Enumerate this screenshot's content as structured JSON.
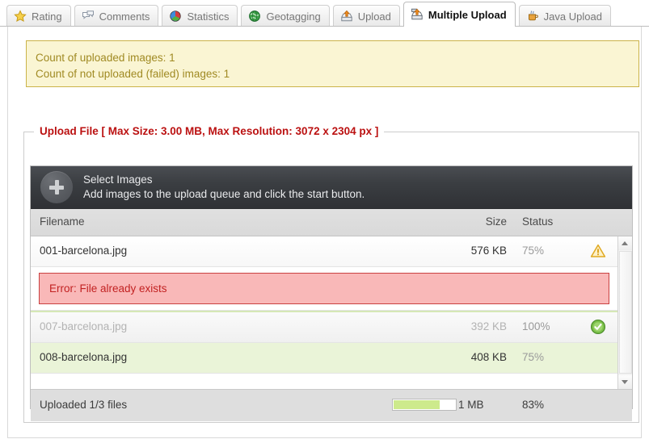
{
  "tabs": [
    {
      "label": "Rating",
      "icon": "star-icon",
      "active": false
    },
    {
      "label": "Comments",
      "icon": "speech-bubble-icon",
      "active": false
    },
    {
      "label": "Statistics",
      "icon": "pie-chart-icon",
      "active": false
    },
    {
      "label": "Geotagging",
      "icon": "globe-icon",
      "active": false
    },
    {
      "label": "Upload",
      "icon": "upload-tray-icon",
      "active": false
    },
    {
      "label": "Multiple Upload",
      "icon": "upload-tray-icon",
      "active": true
    },
    {
      "label": "Java Upload",
      "icon": "java-cup-icon",
      "active": false
    }
  ],
  "notice": {
    "line1": "Count of uploaded images: 1",
    "line2": "Count of not uploaded (failed) images: 1",
    "bg": "#faf5d3",
    "border": "#cbb34a",
    "text": "#a08a23"
  },
  "fieldset": {
    "legend": "Upload File [ Max Size: 3.00 MB, Max Resolution: 3072 x 2304 px ]",
    "legend_color": "#bb1111"
  },
  "dropzone": {
    "title": "Select Images",
    "subtitle": "Add images to the upload queue and click the start button.",
    "button_icon": "plus-icon"
  },
  "table": {
    "columns": {
      "filename": "Filename",
      "size": "Size",
      "status": "Status"
    },
    "rows": [
      {
        "filename": "001-barcelona.jpg",
        "size": "576 KB",
        "percent": "75%",
        "status_icon": "warning-triangle-icon",
        "state": "warn",
        "error": "Error: File already exists"
      },
      {
        "filename": "007-barcelona.jpg",
        "size": "392 KB",
        "percent": "100%",
        "status_icon": "check-circle-icon",
        "state": "done",
        "error": null
      },
      {
        "filename": "008-barcelona.jpg",
        "size": "408 KB",
        "percent": "75%",
        "status_icon": null,
        "state": "ok",
        "error": null
      }
    ]
  },
  "footer": {
    "status": "Uploaded 1/3 files",
    "total_size": "1 MB",
    "percent": "83%",
    "progress_value": 75,
    "progress_color": "#cdea8c"
  },
  "scrollbar": {
    "up_icon": "chevron-up-icon",
    "down_icon": "chevron-down-icon"
  }
}
